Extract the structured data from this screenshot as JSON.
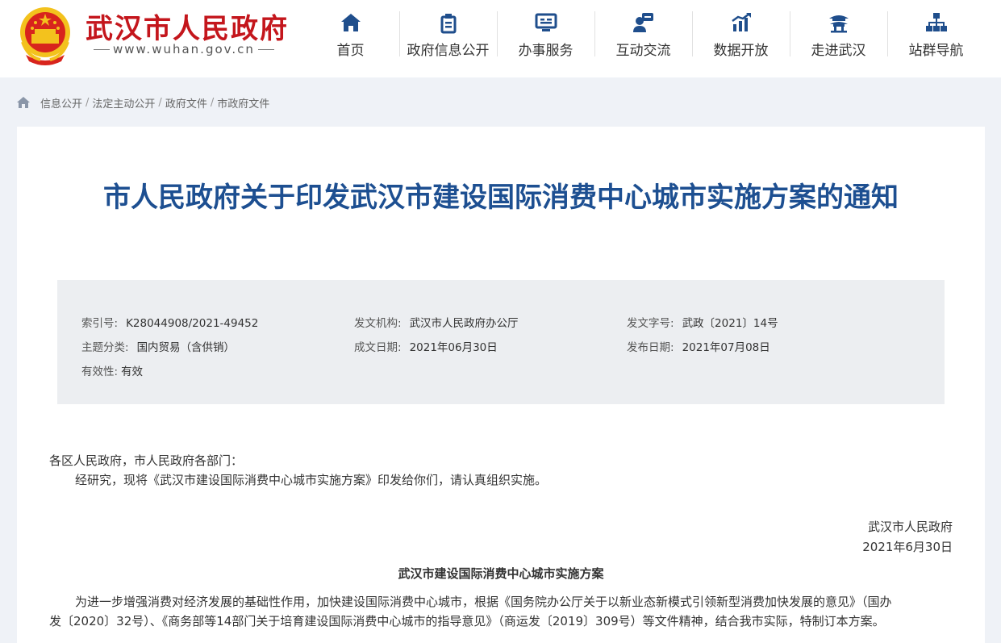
{
  "header": {
    "site_name": "武汉市人民政府",
    "site_url": "www.wuhan.gov.cn",
    "nav": [
      {
        "label": "首页",
        "icon": "home-icon"
      },
      {
        "label": "政府信息公开",
        "icon": "document-icon"
      },
      {
        "label": "办事服务",
        "icon": "service-monitor-icon"
      },
      {
        "label": "互动交流",
        "icon": "chat-person-icon"
      },
      {
        "label": "数据开放",
        "icon": "bar-chart-icon"
      },
      {
        "label": "走进武汉",
        "icon": "pavilion-icon"
      },
      {
        "label": "站群导航",
        "icon": "sitemap-icon"
      }
    ]
  },
  "breadcrumb": [
    "信息公开",
    "法定主动公开",
    "政府文件",
    "市政府文件"
  ],
  "article": {
    "title": "市人民政府关于印发武汉市建设国际消费中心城市实施方案的通知",
    "meta": {
      "index_no_label": "索引号:",
      "index_no": "K28044908/2021-49452",
      "issuer_label": "发文机构:",
      "issuer": "武汉市人民政府办公厅",
      "doc_no_label": "发文字号:",
      "doc_no": "武政〔2021〕14号",
      "topic_label": "主题分类:",
      "topic": "国内贸易（含供销）",
      "written_label": "成文日期:",
      "written_date": "2021年06月30日",
      "published_label": "发布日期:",
      "published_date": "2021年07月08日",
      "validity_label": "有效性:",
      "validity": "有效"
    },
    "salutation": "各区人民政府，市人民政府各部门：",
    "para1": "经研究，现将《武汉市建设国际消费中心城市实施方案》印发给你们，请认真组织实施。",
    "signature_org": "武汉市人民政府",
    "signature_date": "2021年6月30日",
    "plan_title": "武汉市建设国际消费中心城市实施方案",
    "plan_para_line1": "为进一步增强消费对经济发展的基础性作用，加快建设国际消费中心城市，根据《国务院办公厅关于以新业态新模式引领新型消费加快发展的意见》（国办",
    "plan_para_line2": "发〔2020〕32号）、《商务部等14部门关于培育建设国际消费中心城市的指导意见》（商运发〔2019〕309号）等文件精神，结合我市实际，特制订本方案。"
  },
  "colors": {
    "brand_red": "#c4161c",
    "title_blue": "#1d4f91",
    "nav_icon_blue": "#1f4e8c",
    "page_bg": "#eff2f7",
    "meta_bg": "#eceef1"
  }
}
